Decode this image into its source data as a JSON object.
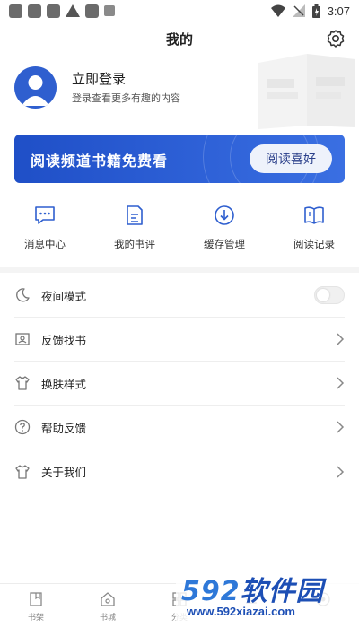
{
  "status_bar": {
    "time": "3:07",
    "left_icons": [
      "notification-icon",
      "notification-icon",
      "notification-icon",
      "warning-icon",
      "image-icon",
      "a-icon"
    ],
    "right_icons": [
      "wifi-icon",
      "signal-icon",
      "battery-icon"
    ]
  },
  "header": {
    "title": "我的",
    "settings_icon": "gear-icon"
  },
  "profile": {
    "title": "立即登录",
    "subtitle": "登录查看更多有趣的内容",
    "avatar_icon": "user-avatar-icon"
  },
  "banner": {
    "text": "阅读频道书籍免费看",
    "button_label": "阅读喜好",
    "color": "#2454cc"
  },
  "quick_actions": [
    {
      "label": "消息中心",
      "icon": "message-icon"
    },
    {
      "label": "我的书评",
      "icon": "review-icon"
    },
    {
      "label": "缓存管理",
      "icon": "download-icon"
    },
    {
      "label": "阅读记录",
      "icon": "book-open-icon"
    }
  ],
  "settings": [
    {
      "label": "夜间模式",
      "icon": "moon-icon",
      "control": "toggle",
      "enabled": false
    },
    {
      "label": "反馈找书",
      "icon": "search-book-icon",
      "control": "chevron"
    },
    {
      "label": "换肤样式",
      "icon": "shirt-icon",
      "control": "chevron"
    },
    {
      "label": "帮助反馈",
      "icon": "help-icon",
      "control": "chevron"
    },
    {
      "label": "关于我们",
      "icon": "shirt-icon",
      "control": "chevron"
    }
  ],
  "bottom_nav": [
    {
      "label": "书架",
      "icon": "bookshelf-icon"
    },
    {
      "label": "书城",
      "icon": "store-icon"
    },
    {
      "label": "分类",
      "icon": "category-icon"
    },
    {
      "label": "",
      "icon": "list-icon"
    },
    {
      "label": "",
      "icon": "profile-icon"
    }
  ],
  "watermark": {
    "brand_num": "592",
    "brand_text": "软件园",
    "url": "www.592xiazai.com"
  }
}
